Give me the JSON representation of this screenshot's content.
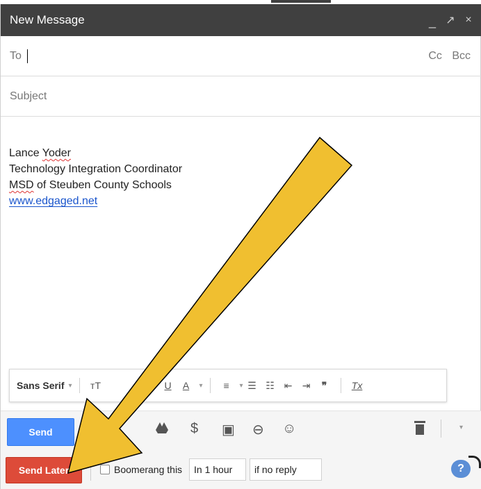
{
  "window": {
    "title": "New Message",
    "controls": {
      "minimize": "_",
      "popout": "↗",
      "close": "×"
    }
  },
  "to": {
    "label": "To",
    "value": "",
    "cc": "Cc",
    "bcc": "Bcc"
  },
  "subject": {
    "placeholder": "Subject",
    "value": ""
  },
  "signature": {
    "name_first": "Lance",
    "name_last": "Yoder",
    "title": "Technology Integration Coordinator",
    "org_abbr": "MSD",
    "org_rest": "of Steuben County Schools",
    "link": "www.edgaged.net"
  },
  "format": {
    "font": "Sans Serif",
    "dropdown": "▾",
    "size": "тT",
    "underline": "U",
    "text_color": "A",
    "align": "≡",
    "numbered": "☰",
    "bulleted": "☷",
    "indent_less": "⇤",
    "indent_more": "⇥",
    "quote": "❞",
    "clear": "Tx"
  },
  "toolbar": {
    "send": "Send",
    "drive_icon": "drive-icon",
    "money": "$",
    "photo": "▣",
    "link": "⊖",
    "emoji": "☺",
    "more": "▾"
  },
  "sendlater": {
    "button": "Send Later",
    "boomerang": "Boomerang this",
    "time_option": "In 1 hour",
    "condition": "if no reply",
    "help": "?"
  },
  "colors": {
    "arrow_fill": "#f0bf30",
    "send_blue": "#4d90fe",
    "sendlater_red": "#dd4b39",
    "titlebar": "#404040"
  }
}
